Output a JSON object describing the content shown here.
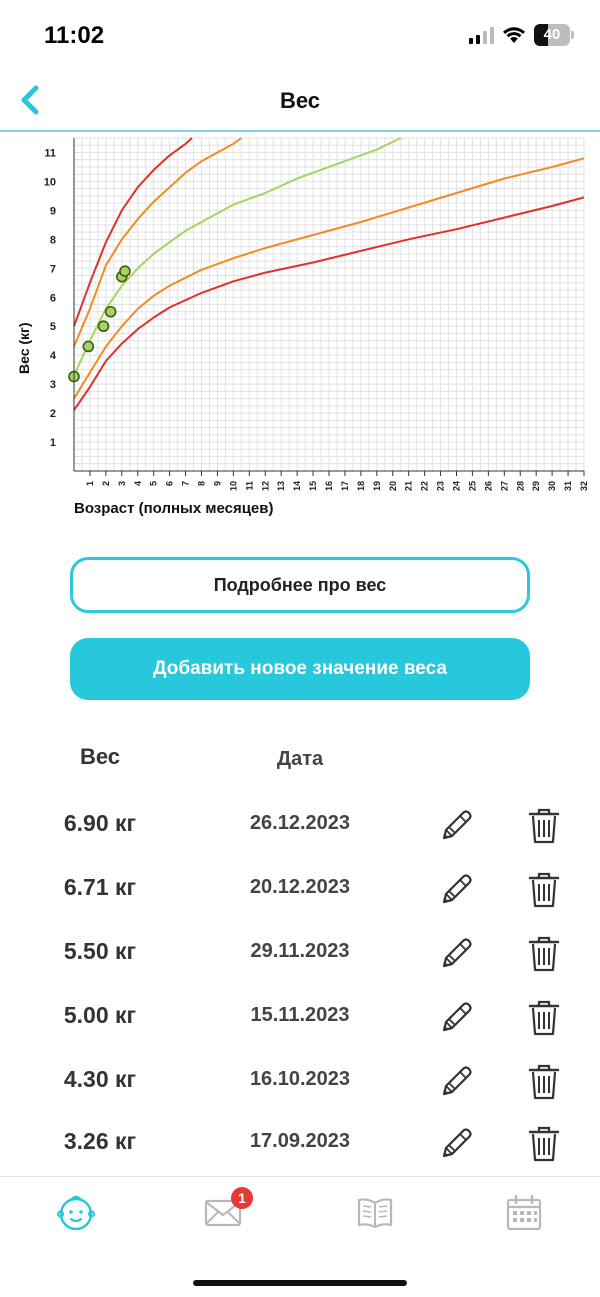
{
  "status_bar": {
    "time": "11:02",
    "battery": "40",
    "battery_level": 0.4
  },
  "header": {
    "title": "Вес"
  },
  "chart_data": {
    "type": "line",
    "ylabel": "Вес (кг)",
    "xlabel": "Возраст (полных месяцев)",
    "xlim": [
      0,
      32
    ],
    "ylim": [
      0,
      11.5
    ],
    "x_ticks": [
      "1",
      "2",
      "3",
      "4",
      "5",
      "6",
      "7",
      "8",
      "9",
      "10",
      "11",
      "12",
      "13",
      "14",
      "15",
      "16",
      "17",
      "18",
      "19",
      "20",
      "21",
      "22",
      "23",
      "24",
      "25",
      "26",
      "27",
      "28",
      "29",
      "30",
      "31",
      "32"
    ],
    "y_ticks": [
      "1",
      "2",
      "3",
      "4",
      "5",
      "6",
      "7",
      "8",
      "9",
      "10",
      "11"
    ],
    "grid": true,
    "curves": [
      {
        "color": "#e0312b",
        "points": [
          [
            0,
            2.1
          ],
          [
            1,
            2.9
          ],
          [
            2,
            3.8
          ],
          [
            3,
            4.4
          ],
          [
            4,
            4.9
          ],
          [
            5,
            5.3
          ],
          [
            6,
            5.65
          ],
          [
            8,
            6.15
          ],
          [
            10,
            6.55
          ],
          [
            12,
            6.85
          ],
          [
            15,
            7.2
          ],
          [
            18,
            7.6
          ],
          [
            21,
            8.0
          ],
          [
            24,
            8.35
          ],
          [
            27,
            8.75
          ],
          [
            30,
            9.15
          ],
          [
            32,
            9.45
          ]
        ]
      },
      {
        "color": "#f28c22",
        "points": [
          [
            0,
            2.5
          ],
          [
            1,
            3.4
          ],
          [
            2,
            4.3
          ],
          [
            3,
            5.0
          ],
          [
            4,
            5.6
          ],
          [
            5,
            6.05
          ],
          [
            6,
            6.4
          ],
          [
            8,
            6.95
          ],
          [
            10,
            7.35
          ],
          [
            12,
            7.7
          ],
          [
            15,
            8.15
          ],
          [
            18,
            8.6
          ],
          [
            21,
            9.1
          ],
          [
            24,
            9.6
          ],
          [
            27,
            10.1
          ],
          [
            30,
            10.5
          ],
          [
            32,
            10.8
          ]
        ]
      },
      {
        "color": "#a4d65e",
        "points": [
          [
            0,
            3.3
          ],
          [
            1,
            4.5
          ],
          [
            2,
            5.6
          ],
          [
            3,
            6.4
          ],
          [
            4,
            7.0
          ],
          [
            5,
            7.5
          ],
          [
            6,
            7.9
          ],
          [
            7,
            8.3
          ],
          [
            8,
            8.6
          ],
          [
            10,
            9.2
          ],
          [
            12,
            9.6
          ],
          [
            14,
            10.1
          ],
          [
            17,
            10.7
          ],
          [
            19,
            11.1
          ],
          [
            20.5,
            11.5
          ]
        ]
      },
      {
        "color": "#f28c22",
        "points": [
          [
            0,
            4.3
          ],
          [
            1,
            5.6
          ],
          [
            2,
            7.1
          ],
          [
            3,
            8.0
          ],
          [
            4,
            8.7
          ],
          [
            5,
            9.3
          ],
          [
            6,
            9.8
          ],
          [
            7,
            10.3
          ],
          [
            8,
            10.7
          ],
          [
            9,
            11.0
          ],
          [
            10,
            11.3
          ],
          [
            10.5,
            11.5
          ]
        ]
      },
      {
        "color": "#e0312b",
        "points": [
          [
            0,
            5.0
          ],
          [
            1,
            6.5
          ],
          [
            2,
            7.9
          ],
          [
            3,
            9.0
          ],
          [
            4,
            9.8
          ],
          [
            5,
            10.4
          ],
          [
            6,
            10.9
          ],
          [
            7,
            11.3
          ],
          [
            7.4,
            11.5
          ]
        ]
      }
    ],
    "measurements": [
      {
        "x": 0,
        "y": 3.26
      },
      {
        "x": 0.9,
        "y": 4.3
      },
      {
        "x": 1.85,
        "y": 5.0
      },
      {
        "x": 2.3,
        "y": 5.5
      },
      {
        "x": 3.0,
        "y": 6.71
      },
      {
        "x": 3.2,
        "y": 6.9
      }
    ],
    "colors": {
      "grid": "#e2e2e2",
      "axis": "#333333",
      "point_fill": "#a4d65e",
      "point_stroke": "#3f5a1f"
    }
  },
  "buttons": {
    "details_label": "Подробнее про вес",
    "add_label": "Добавить новое значение веса"
  },
  "table": {
    "headers": {
      "weight": "Вес",
      "date": "Дата"
    },
    "rows": [
      {
        "weight": "6.90 кг",
        "date": "26.12.2023"
      },
      {
        "weight": "6.71 кг",
        "date": "20.12.2023"
      },
      {
        "weight": "5.50 кг",
        "date": "29.11.2023"
      },
      {
        "weight": "5.00 кг",
        "date": "15.11.2023"
      },
      {
        "weight": "4.30 кг",
        "date": "16.10.2023"
      },
      {
        "weight": "3.26 кг",
        "date": "17.09.2023"
      }
    ]
  },
  "tabbar": {
    "items": [
      {
        "icon": "baby-face-icon",
        "active": true
      },
      {
        "icon": "mail-icon",
        "badge": "1"
      },
      {
        "icon": "book-icon"
      },
      {
        "icon": "calendar-icon"
      }
    ]
  },
  "colors": {
    "accent": "#27c7dc",
    "tab_active": "#27c7dc",
    "tab_inactive": "#b8b8b8"
  }
}
